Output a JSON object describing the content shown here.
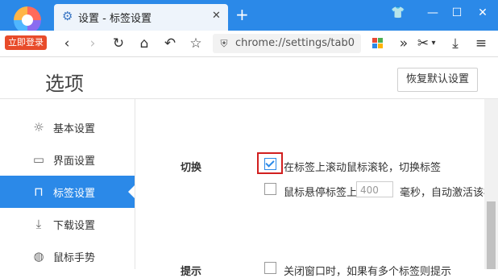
{
  "colors": {
    "accent": "#2b89e8",
    "highlight": "#d11f1f",
    "login_badge": "#e84b2a"
  },
  "browser": {
    "login_label": "立即登录",
    "tab_title": "设置 - 标签设置",
    "tab_close": "✕",
    "new_tab": "+",
    "window_controls": {
      "skin": "👕",
      "minimize": "—",
      "maximize": "☐",
      "close": "✕"
    },
    "toolbar": {
      "back": "‹",
      "forward": "›",
      "reload": "↻",
      "home": "⌂",
      "undo": "↶",
      "star": "☆",
      "more": "»",
      "cut": "✂",
      "cut_caret": "▾",
      "download": "⤓",
      "menu": "≡"
    },
    "address": "chrome://settings/tab0"
  },
  "page": {
    "title": "选项",
    "reset_button": "恢复默认设置"
  },
  "sidebar": {
    "items": [
      {
        "label": "基本设置",
        "icon": "gear-icon",
        "glyph": "☼"
      },
      {
        "label": "界面设置",
        "icon": "window-icon",
        "glyph": "▭"
      },
      {
        "label": "标签设置",
        "icon": "tab-icon",
        "glyph": "⊓",
        "active": true
      },
      {
        "label": "下载设置",
        "icon": "download-icon",
        "glyph": "⤓"
      },
      {
        "label": "鼠标手势",
        "icon": "mouse-icon",
        "glyph": "◍"
      }
    ]
  },
  "content": {
    "switch_section": {
      "label": "切换",
      "options": [
        {
          "text": "在标签上滚动鼠标滚轮，切换标签",
          "checked": true
        },
        {
          "text_before": "鼠标悬停标签上",
          "value_placeholder": "400",
          "text_after": "毫秒，自动激活该标",
          "checked": false
        }
      ]
    },
    "tip_section": {
      "label": "提示",
      "options": [
        {
          "text": "关闭窗口时，如果有多个标签则提示",
          "checked": false
        }
      ]
    }
  }
}
